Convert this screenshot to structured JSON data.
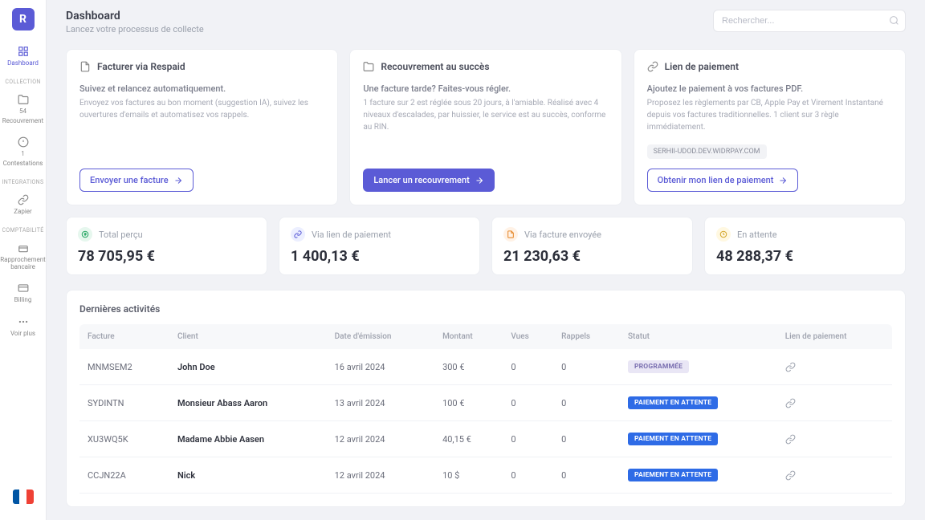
{
  "sidebar": {
    "logo_letter": "R",
    "items": [
      {
        "label": "Dashboard"
      },
      {
        "label": "54",
        "sub": "Recouvrement"
      },
      {
        "label": "1",
        "sub": "Contestations"
      },
      {
        "label": "Zapier"
      },
      {
        "label": "Rapprochement bancaire"
      },
      {
        "label": "Billing"
      },
      {
        "label": "Voir plus"
      }
    ],
    "sections": {
      "collection": "COLLECTION",
      "integrations": "INTEGRATIONS",
      "comptabilite": "COMPTABILITÉ"
    }
  },
  "header": {
    "title": "Dashboard",
    "subtitle": "Lancez votre processus de collecte",
    "search_placeholder": "Rechercher..."
  },
  "cards": [
    {
      "title": "Facturer via Respaid",
      "sub": "Suivez et relancez automatiquement.",
      "desc": "Envoyez vos factures au bon moment (suggestion IA), suivez les ouvertures d'emails et automatisez vos rappels.",
      "button": "Envoyer une facture"
    },
    {
      "title": "Recouvrement au succès",
      "sub": "Une facture tarde? Faites-vous régler.",
      "desc": "1 facture sur 2 est réglée sous 20 jours, à l'amiable. Réalisé avec 4 niveaux d'escalades, par huissier, le service est au succès, conforme au RIN.",
      "button": "Lancer un recouvrement"
    },
    {
      "title": "Lien de paiement",
      "sub": "Ajoutez le paiement à vos factures PDF.",
      "desc": "Proposez les règlements par CB, Apple Pay et Virement Instantané depuis vos factures traditionnelles. 1 client sur 3 règle immédiatement.",
      "url": "SERHII-UDOD.DEV.WIDRPAY.COM",
      "button": "Obtenir mon lien de paiement"
    }
  ],
  "stats": [
    {
      "label": "Total perçu",
      "value": "78 705,95 €"
    },
    {
      "label": "Via lien de paiement",
      "value": "1 400,13 €"
    },
    {
      "label": "Via facture envoyée",
      "value": "21 230,63 €"
    },
    {
      "label": "En attente",
      "value": "48 288,37 €"
    }
  ],
  "table": {
    "title": "Dernières activités",
    "headers": {
      "facture": "Facture",
      "client": "Client",
      "date": "Date d'émission",
      "montant": "Montant",
      "vues": "Vues",
      "rappels": "Rappels",
      "statut": "Statut",
      "lien": "Lien de paiement"
    },
    "rows": [
      {
        "facture": "MNMSEM2",
        "client": "John Doe",
        "date": "16 avril 2024",
        "montant": "300 €",
        "vues": "0",
        "rappels": "0",
        "statut": "PROGRAMMÉE",
        "statut_class": "prog"
      },
      {
        "facture": "SYDINTN",
        "client": "Monsieur Abass Aaron",
        "date": "13 avril 2024",
        "montant": "100 €",
        "vues": "0",
        "rappels": "0",
        "statut": "PAIEMENT EN ATTENTE",
        "statut_class": "wait"
      },
      {
        "facture": "XU3WQ5K",
        "client": "Madame Abbie Aasen",
        "date": "12 avril 2024",
        "montant": "40,15 €",
        "vues": "0",
        "rappels": "0",
        "statut": "PAIEMENT EN ATTENTE",
        "statut_class": "wait"
      },
      {
        "facture": "CCJN22A",
        "client": "Nick",
        "date": "12 avril 2024",
        "montant": "10 $",
        "vues": "0",
        "rappels": "0",
        "statut": "PAIEMENT EN ATTENTE",
        "statut_class": "wait"
      }
    ]
  }
}
